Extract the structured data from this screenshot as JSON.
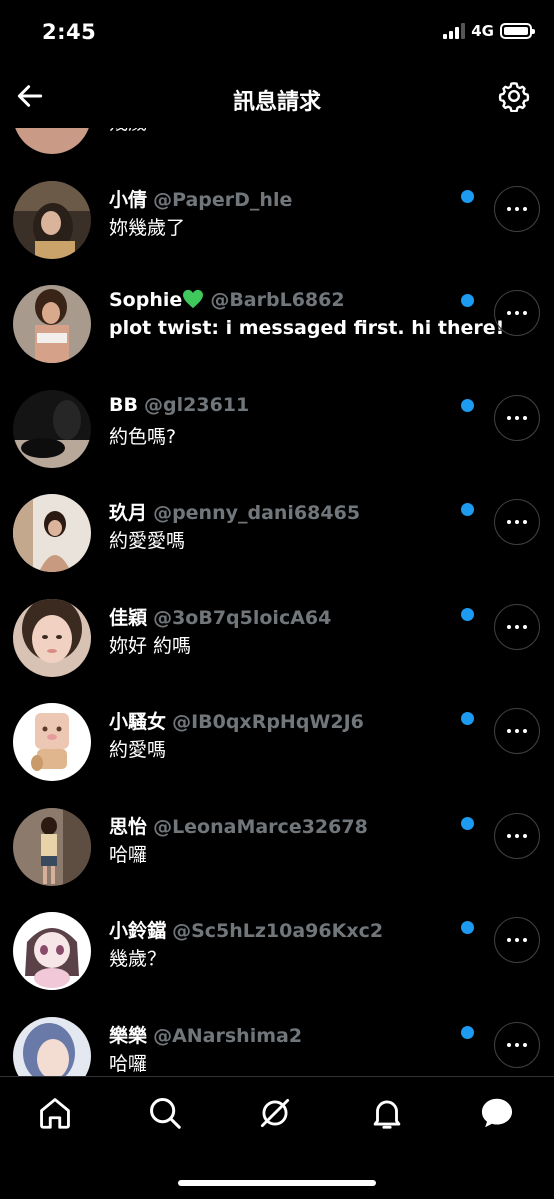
{
  "status_bar": {
    "time": "2:45",
    "network": "4G"
  },
  "header": {
    "title": "訊息請求"
  },
  "partial_top": {
    "message": "幾歲"
  },
  "requests": [
    {
      "name": "小倩",
      "handle": "@PaperD_hle",
      "message": "妳幾歲了",
      "bold_message": false,
      "unread": true
    },
    {
      "name": "Sophie",
      "handle": "@BarbL6862",
      "message": "plot twist: i messaged first. hi there!",
      "bold_message": true,
      "unread": true,
      "emoji": "green-heart-icon"
    },
    {
      "name": "BB",
      "handle": "@gl23611",
      "message": "約色嗎?",
      "bold_message": false,
      "unread": true
    },
    {
      "name": "玖月",
      "handle": "@penny_dani68465",
      "message": "約愛愛嗎",
      "bold_message": false,
      "unread": true
    },
    {
      "name": "佳穎",
      "handle": "@3oB7q5loicA64",
      "message": "妳好 約嗎",
      "bold_message": false,
      "unread": true
    },
    {
      "name": "小騷女",
      "handle": "@IB0qxRpHqW2J6",
      "message": "約愛嗎",
      "bold_message": false,
      "unread": true
    },
    {
      "name": "思怡",
      "handle": "@LeonaMarce32678",
      "message": "哈囉",
      "bold_message": false,
      "unread": true
    },
    {
      "name": "小鈴鐺",
      "handle": "@Sc5hLz10a96Kxc2",
      "message": "幾歲？",
      "bold_message": false,
      "unread": true
    },
    {
      "name": "樂樂",
      "handle": "@ANarshima2",
      "message": "哈囉",
      "bold_message": false,
      "unread": true
    }
  ],
  "tabbar": {
    "items": [
      "home-icon",
      "search-icon",
      "spaces-icon",
      "notifications-icon",
      "messages-icon"
    ]
  },
  "colors": {
    "background": "#000000",
    "accent": "#1d9bf0",
    "handle": "#71767b",
    "green_heart": "#3fc95c"
  }
}
